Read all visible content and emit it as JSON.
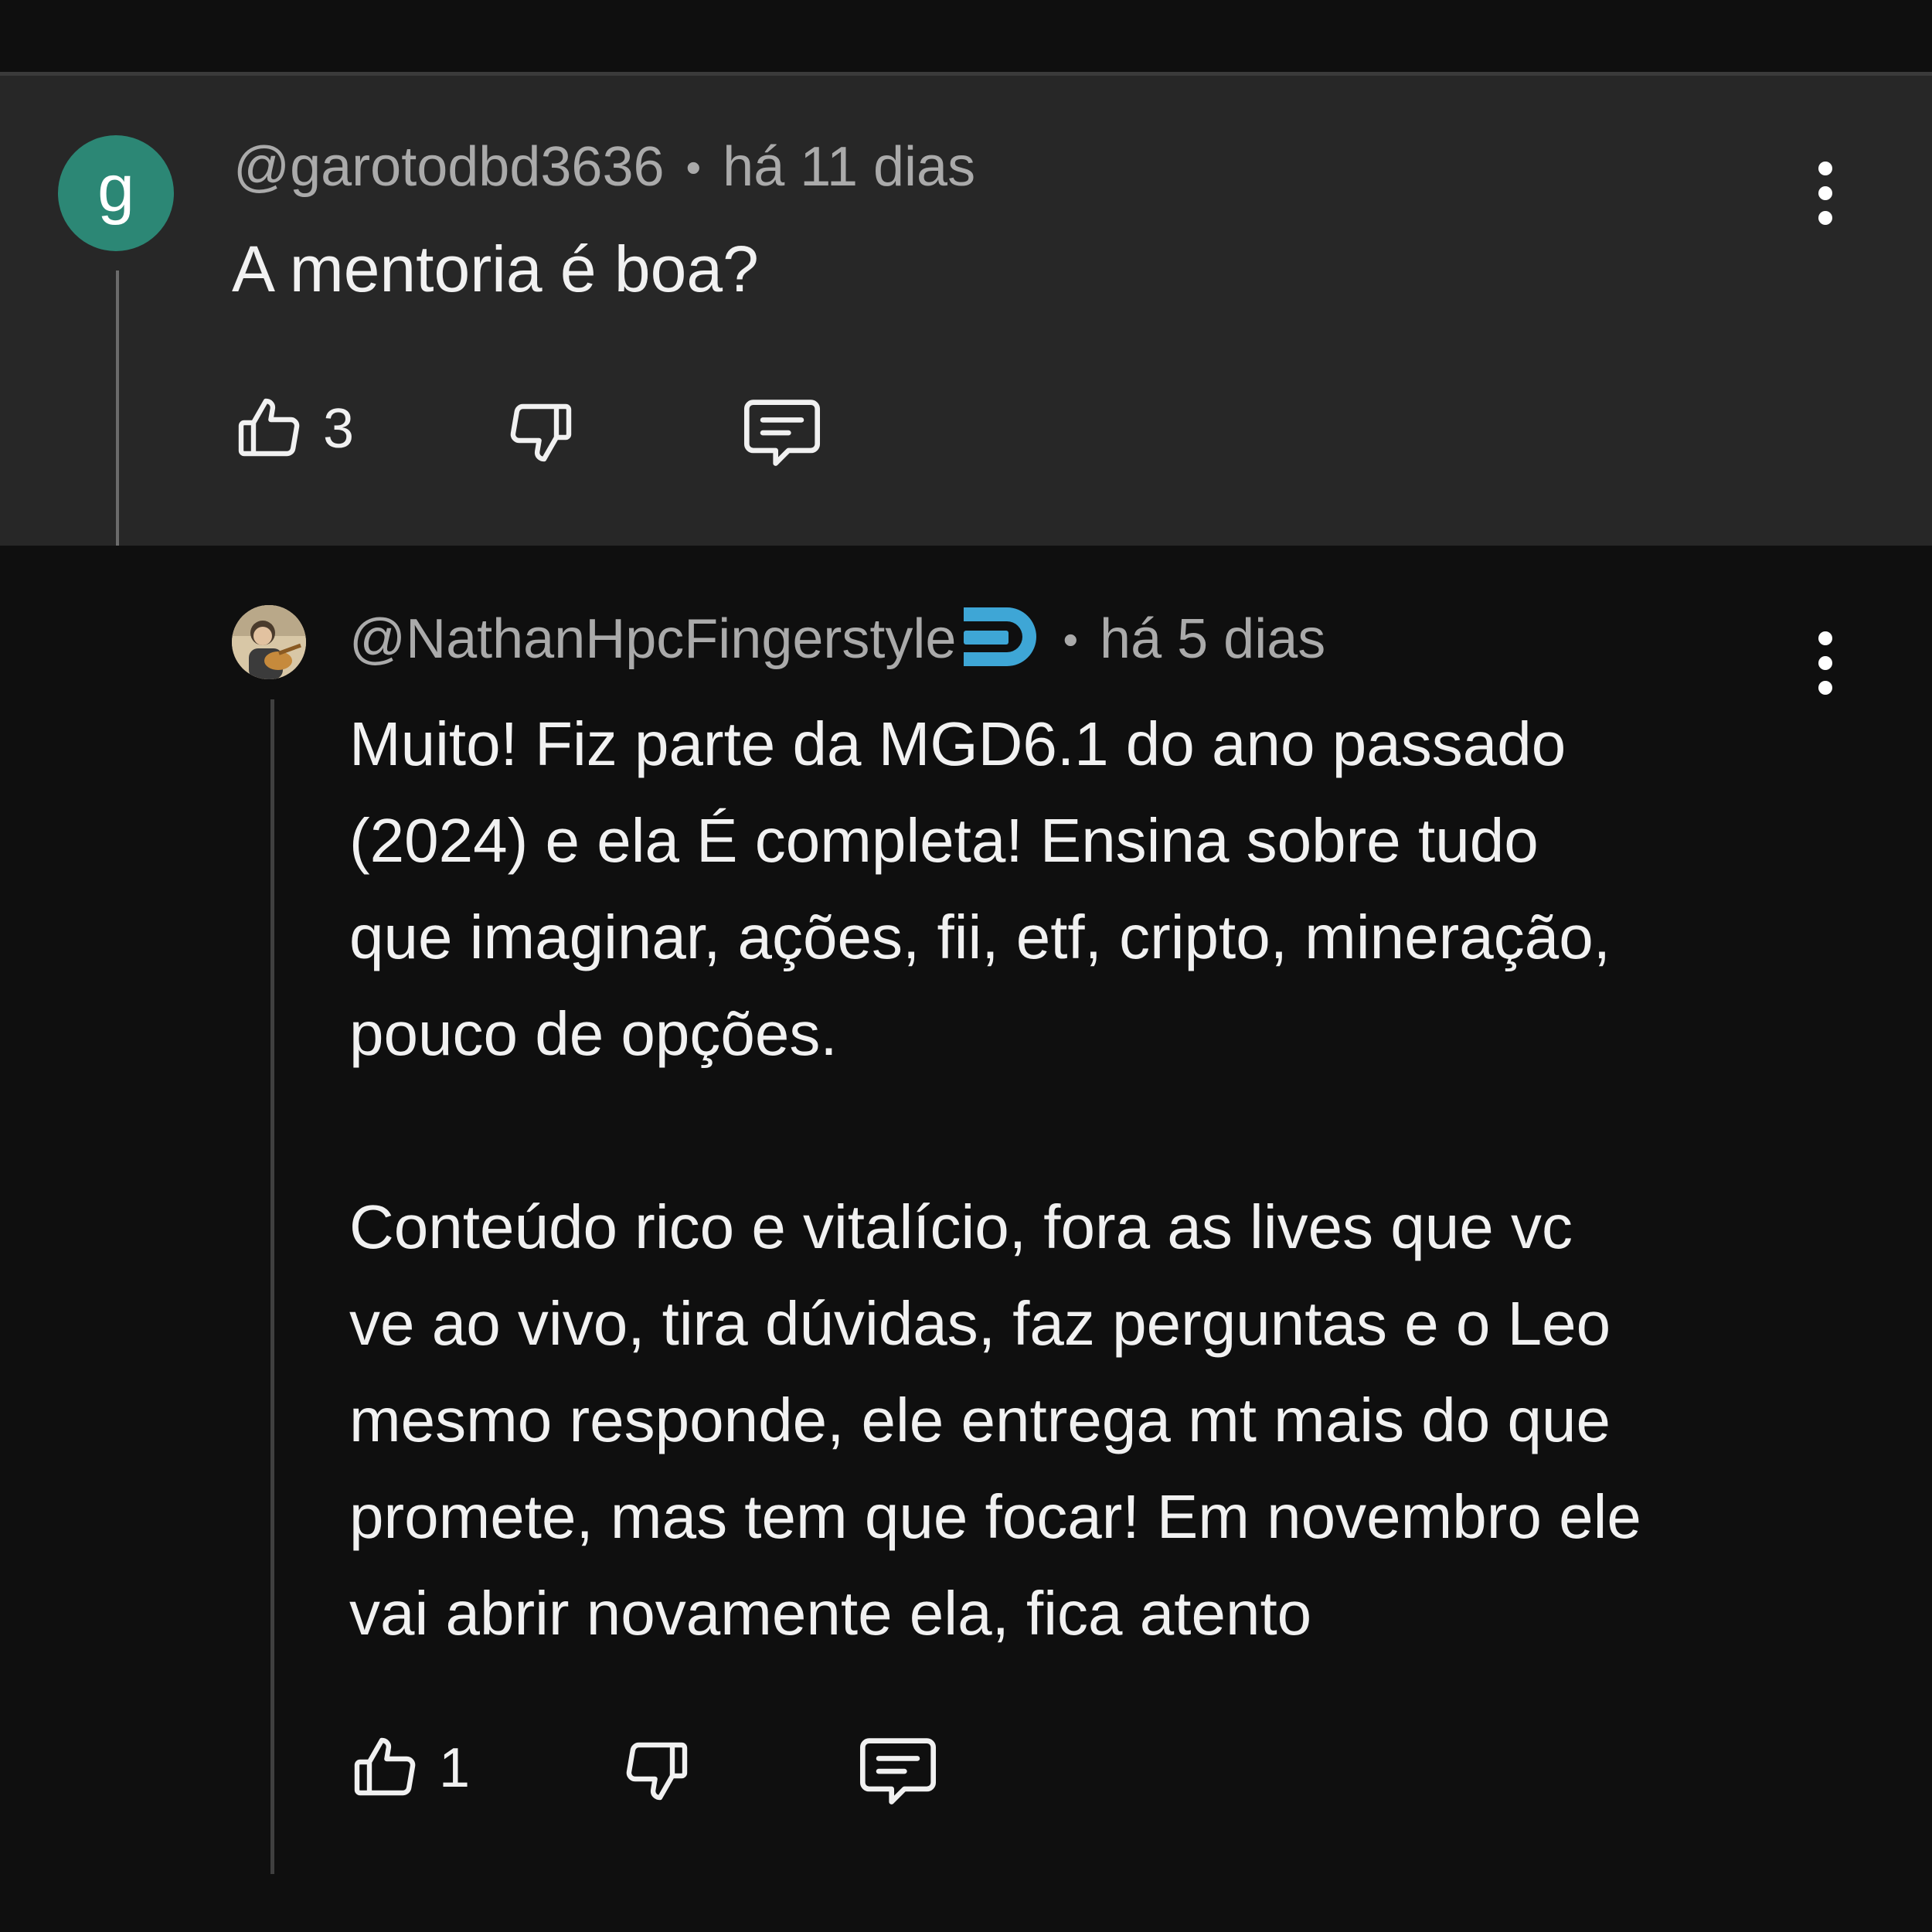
{
  "parent_comment": {
    "avatar_letter": "g",
    "avatar_color": "#2c8775",
    "username": "@garotodbd3636",
    "separator": "•",
    "time": "há 11 dias",
    "text": "A mentoria é boa?",
    "like_count": "3"
  },
  "reply": {
    "username": "@NathanHpcFingerstyle",
    "separator": "•",
    "time": "há 5 dias",
    "paragraph_1": [
      "Muito! Fiz parte da MGD6.1 do ano passado",
      "(2024) e ela É completa! Ensina sobre tudo",
      "que imaginar, ações, fii, etf, cripto, mineração,",
      "pouco de opções."
    ],
    "paragraph_2": [
      "Conteúdo rico e vitalício, fora as lives que vc",
      "ve ao vivo, tira dúvidas, faz perguntas e o Leo",
      "mesmo responde, ele entrega mt mais do que",
      "promete, mas tem que focar! Em novembro ele",
      "vai abrir novamente ela, fica atento"
    ],
    "like_count": "1",
    "badge_color": "#3ea6d6"
  },
  "icons": {
    "like": "thumbs-up-icon",
    "dislike": "thumbs-down-icon",
    "reply": "comment-icon",
    "menu": "more-vertical-icon"
  }
}
